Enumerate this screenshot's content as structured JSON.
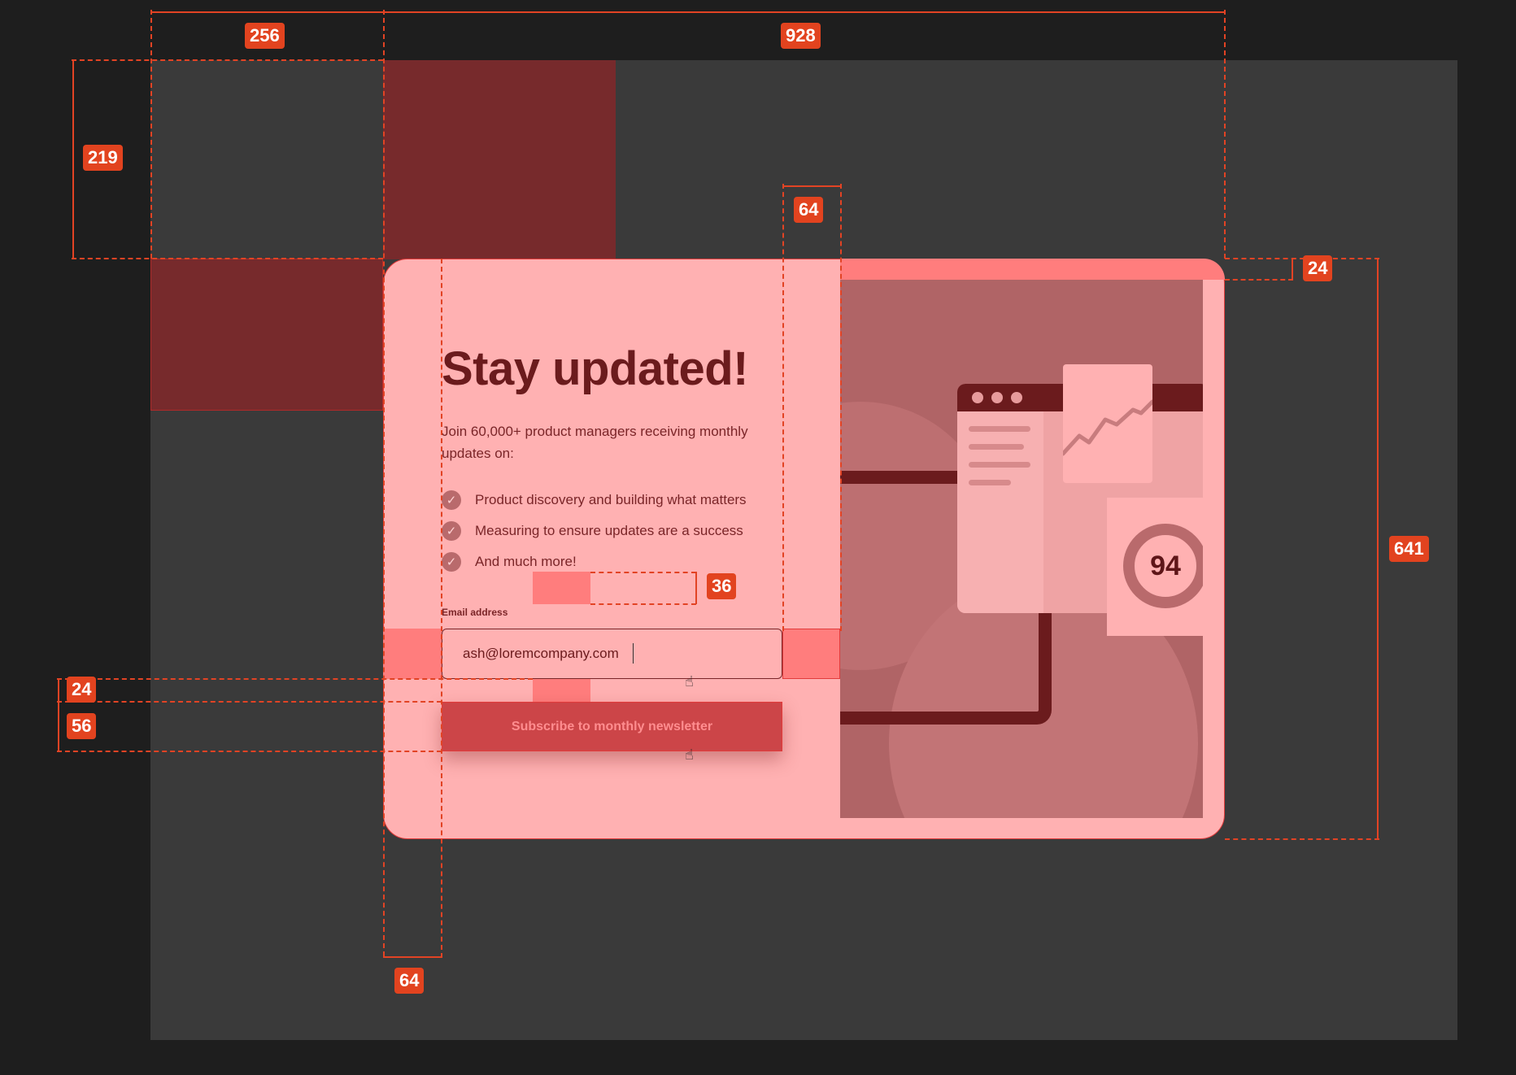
{
  "modal": {
    "title": "Stay updated!",
    "intro": "Join 60,000+ product managers receiving monthly updates on:",
    "bullets": [
      "Product discovery and building what matters",
      "Measuring to ensure updates are a success",
      "And much more!"
    ],
    "email_label": "Email address",
    "email_value": "ash@loremcompany.com",
    "subscribe_label": "Subscribe to monthly newsletter",
    "score": "94"
  },
  "icons": {
    "check": "check-circle-icon",
    "cursor": "hand-pointer-icon"
  },
  "measurements": {
    "left_column_width": "256",
    "content_width": "928",
    "top_offset": "219",
    "image_column_gap": "64",
    "image_top_inset": "24",
    "card_height": "641",
    "list_to_label_gap": "36",
    "input_to_button_gap": "24",
    "button_height": "56",
    "left_padding": "64"
  },
  "colors": {
    "overlay_red": "#e2431f",
    "card_pink": "#ffb1b2",
    "dark_maroon": "#6b1b1d",
    "canvas": "#3a3a3a"
  }
}
